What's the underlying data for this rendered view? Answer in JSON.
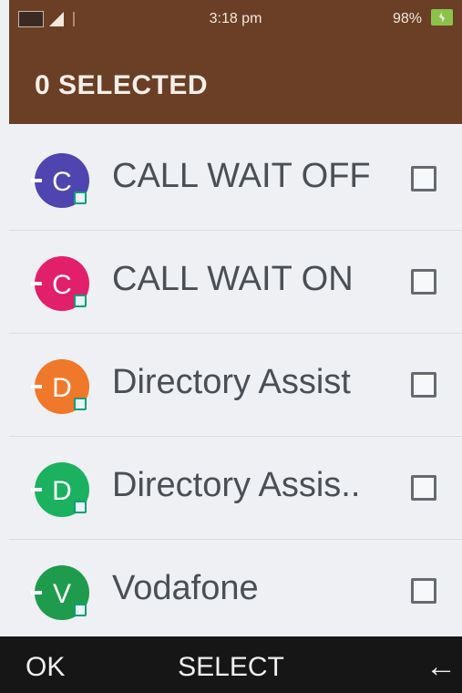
{
  "status_bar": {
    "time": "3:18 pm",
    "battery": "98%",
    "icons": [
      "sim-status-icon",
      "signal-icon",
      "antenna-icon",
      "battery-charging-icon"
    ]
  },
  "header": {
    "title": "0 SELECTED"
  },
  "list": {
    "items": [
      {
        "initial": "C",
        "label": "CALL WAIT OFF",
        "color": "#4f45b0",
        "checked": false
      },
      {
        "initial": "C",
        "label": "CALL WAIT ON",
        "color": "#e21f6b",
        "checked": false
      },
      {
        "initial": "D",
        "label": "Directory Assist",
        "color": "#f0782a",
        "checked": false
      },
      {
        "initial": "D",
        "label": "Directory Assis..",
        "color": "#1bb15f",
        "checked": false
      },
      {
        "initial": "V",
        "label": "Vodafone",
        "color": "#1f9b4d",
        "checked": false
      }
    ]
  },
  "softkeys": {
    "left": "OK",
    "center": "SELECT",
    "right": "←"
  }
}
